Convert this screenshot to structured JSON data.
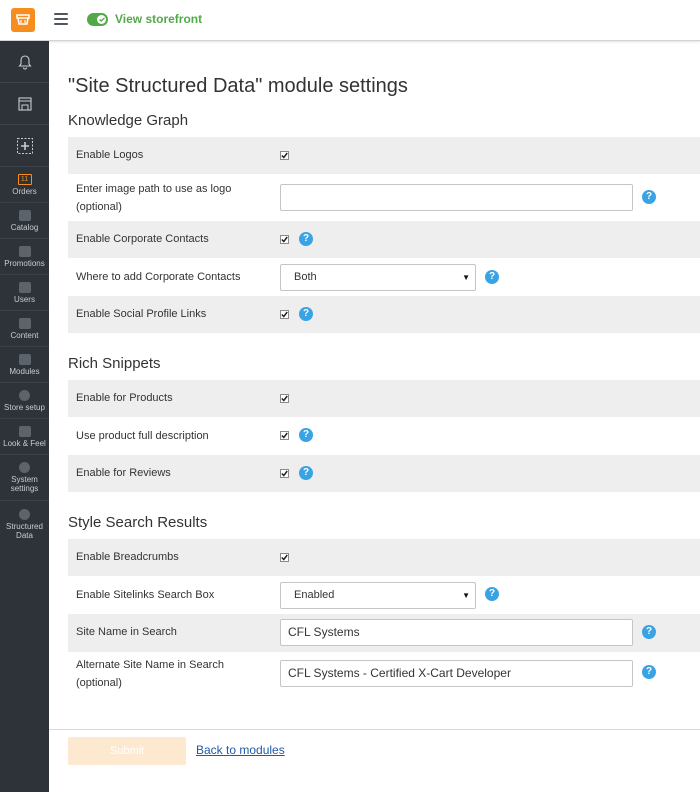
{
  "topbar": {
    "storefront_label": "View storefront"
  },
  "sidebar": {
    "orders_badge": "11",
    "items": [
      {
        "label": "Orders"
      },
      {
        "label": "Catalog"
      },
      {
        "label": "Promotions"
      },
      {
        "label": "Users"
      },
      {
        "label": "Content"
      },
      {
        "label": "Modules"
      },
      {
        "label": "Store setup"
      },
      {
        "label": "Look & Feel"
      },
      {
        "label": "System settings"
      },
      {
        "label": "Structured Data"
      }
    ]
  },
  "page": {
    "title": "\"Site Structured Data\" module settings"
  },
  "sections": [
    {
      "title": "Knowledge Graph"
    },
    {
      "title": "Rich Snippets"
    },
    {
      "title": "Style Search Results"
    }
  ],
  "fields": {
    "enable_logos": {
      "label": "Enable Logos",
      "checked": true
    },
    "logo_path": {
      "label": "Enter image path to use as logo (optional)",
      "value": ""
    },
    "corp_contacts": {
      "label": "Enable Corporate Contacts",
      "checked": true
    },
    "where_contacts": {
      "label": "Where to add Corporate Contacts",
      "value": "Both"
    },
    "social_links": {
      "label": "Enable Social Profile Links",
      "checked": true
    },
    "enable_products": {
      "label": "Enable for Products",
      "checked": true
    },
    "full_description": {
      "label": "Use product full description",
      "checked": true
    },
    "enable_reviews": {
      "label": "Enable for Reviews",
      "checked": true
    },
    "breadcrumbs": {
      "label": "Enable Breadcrumbs",
      "checked": true
    },
    "sitelinks_search": {
      "label": "Enable Sitelinks Search Box",
      "value": "Enabled"
    },
    "site_name": {
      "label": "Site Name in Search",
      "value": "CFL Systems"
    },
    "alt_site_name": {
      "label": "Alternate Site Name in Search (optional)",
      "value": "CFL Systems - Certified X-Cart Developer"
    }
  },
  "actions": {
    "submit_label": "Submit",
    "back_label": "Back to modules"
  },
  "icons": {
    "help": "?",
    "select_arrow": "▼"
  },
  "colors": {
    "accent": "#f58e1f",
    "storefront": "#53a949",
    "help": "#3aa3e3",
    "sidebar": "#2e3339",
    "row_shade": "#eeeeee",
    "link": "#1e5aa8"
  }
}
